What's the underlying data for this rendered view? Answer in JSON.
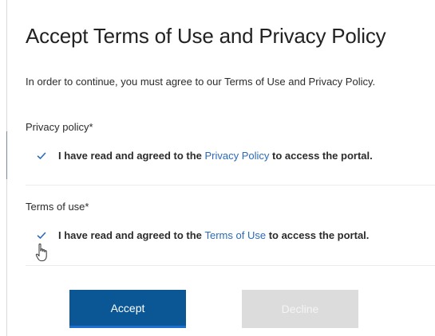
{
  "dialog": {
    "title": "Accept Terms of Use and Privacy Policy",
    "intro": "In order to continue, you must agree to our Terms of Use and Privacy Policy."
  },
  "privacy": {
    "label": "Privacy policy*",
    "prefix": "I have read and agreed to the ",
    "link": "Privacy Policy",
    "suffix": " to access the portal.",
    "checked": true
  },
  "terms": {
    "label": "Terms of use*",
    "prefix": "I have read and agreed to the ",
    "link": "Terms of Use",
    "suffix": " to access the portal.",
    "checked": true
  },
  "buttons": {
    "accept": "Accept",
    "decline": "Decline"
  },
  "colors": {
    "accent": "#0b5796",
    "link": "#2a6ab8",
    "check": "#2a6ab8",
    "disabled": "#dcdcdc"
  },
  "icons": {
    "checkbox": "checkmark-icon",
    "cursor": "hand-pointer-icon"
  }
}
